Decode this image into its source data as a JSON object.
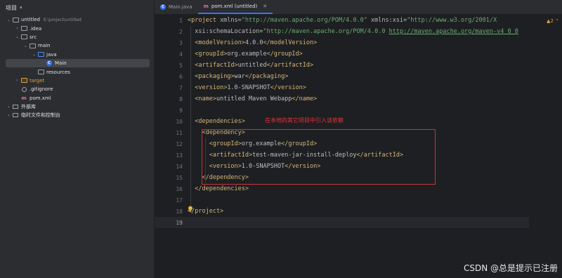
{
  "sidebar": {
    "title": "项目",
    "tree": [
      {
        "label": "untitled",
        "path": "E:\\project\\untitled",
        "indent": 0,
        "arrow": "v",
        "icon": "folder"
      },
      {
        "label": ".idea",
        "indent": 1,
        "arrow": ">",
        "icon": "folder"
      },
      {
        "label": "src",
        "indent": 1,
        "arrow": "v",
        "icon": "folder"
      },
      {
        "label": "main",
        "indent": 2,
        "arrow": "v",
        "icon": "folder"
      },
      {
        "label": "java",
        "indent": 3,
        "arrow": "v",
        "icon": "folder-blue"
      },
      {
        "label": "Main",
        "indent": 4,
        "arrow": "",
        "icon": "class",
        "selected": true
      },
      {
        "label": "resources",
        "indent": 3,
        "arrow": "",
        "icon": "folder"
      },
      {
        "label": "target",
        "indent": 1,
        "arrow": ">",
        "icon": "folder-orange",
        "orange": true
      },
      {
        "label": ".gitignore",
        "indent": 1,
        "arrow": "",
        "icon": "gitignore"
      },
      {
        "label": "pom.xml",
        "indent": 1,
        "arrow": "",
        "icon": "maven"
      },
      {
        "label": "外部库",
        "indent": 0,
        "arrow": ">",
        "icon": "library"
      },
      {
        "label": "临时文件和控制台",
        "indent": 0,
        "arrow": ">",
        "icon": "scratch"
      }
    ]
  },
  "tabs": [
    {
      "label": "Main.java",
      "icon": "class",
      "active": false
    },
    {
      "label": "pom.xml (untitled)",
      "icon": "maven",
      "active": true
    }
  ],
  "editor": {
    "warning_count": "2",
    "line_numbers": [
      "1",
      "2",
      "3",
      "4",
      "5",
      "6",
      "7",
      "8",
      "9",
      "10",
      "11",
      "12",
      "13",
      "14",
      "15",
      "16",
      "17",
      "18",
      "19"
    ],
    "current_line": "19",
    "annotation": "在本地的其它项目中引入该依赖"
  },
  "watermark": "CSDN @总是提示已注册",
  "colors": {
    "accent": "#3574f0",
    "highlight_box": "#c8353b",
    "annotation": "#e8333b"
  }
}
